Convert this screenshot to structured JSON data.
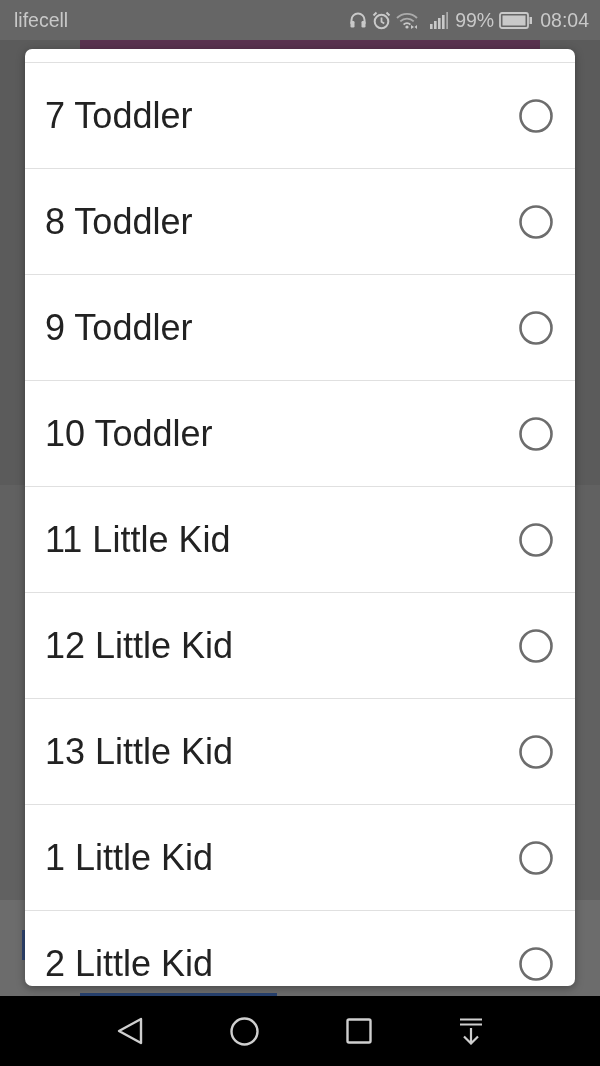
{
  "status_bar": {
    "carrier": "lifecell",
    "battery": "99%",
    "time": "08:04"
  },
  "dialog": {
    "options": [
      {
        "label": "7 Toddler",
        "selected": false
      },
      {
        "label": "8 Toddler",
        "selected": false
      },
      {
        "label": "9 Toddler",
        "selected": false
      },
      {
        "label": "10 Toddler",
        "selected": false
      },
      {
        "label": "11 Little Kid",
        "selected": false
      },
      {
        "label": "12 Little Kid",
        "selected": false
      },
      {
        "label": "13 Little Kid",
        "selected": false
      },
      {
        "label": "1 Little Kid",
        "selected": false
      },
      {
        "label": "2 Little Kid",
        "selected": false
      }
    ]
  }
}
